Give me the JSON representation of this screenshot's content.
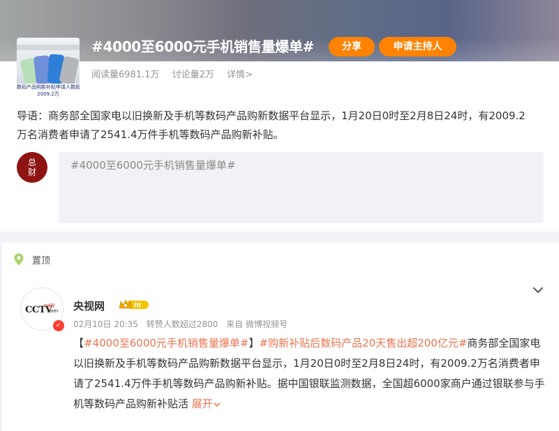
{
  "topic": {
    "thumb_caption": [
      "数码产品购新补贴申请人数超",
      "2009.2万"
    ],
    "title": "#4000至6000元手机销售量爆单#",
    "share_label": "分享",
    "host_label": "申请主持人",
    "reads": "阅读量6981.1万",
    "discussions": "讨论量2万",
    "details": "详情>",
    "intro": "导语：商务部全国家电以旧换新及手机等数码产品购新数据平台显示，1月20日0时至2月8日24时，有2009.2万名消费者申请了2541.4万件手机等数码产品购新补贴。"
  },
  "composer": {
    "avatar_text": "总财",
    "placeholder": "#4000至6000元手机销售量爆单#"
  },
  "feed": {
    "pinned_label": "置顶",
    "author": "央视网",
    "vip_level": "III",
    "time": "02月10日 20:35",
    "reposts": "转赞人数超过2800",
    "source": "来自 微博视频号",
    "avatar_logo": "CCTV",
    "avatar_logo_sub": "中视网",
    "avatar_logo_com": ".com",
    "post": {
      "bracket_open": "【",
      "tag1": "#4000至6000元手机销售量爆单#",
      "bracket_close": "】",
      "tag2": "#购新补贴后数码产品20天售出超200亿元#",
      "text": "商务部全国家电以旧换新及手机等数码产品购新数据平台显示，1月20日0时至2月8日24时，有2009.2万名消费者申请了2541.4万件手机等数码产品购新补贴。据中国银联监测数据，全国超6000家商户通过银联参与手机等数码产品购新补贴活",
      "expand_label": "展开"
    }
  },
  "colors": {
    "accent": "#ff8200",
    "link": "#eb7350",
    "muted": "#939393"
  }
}
